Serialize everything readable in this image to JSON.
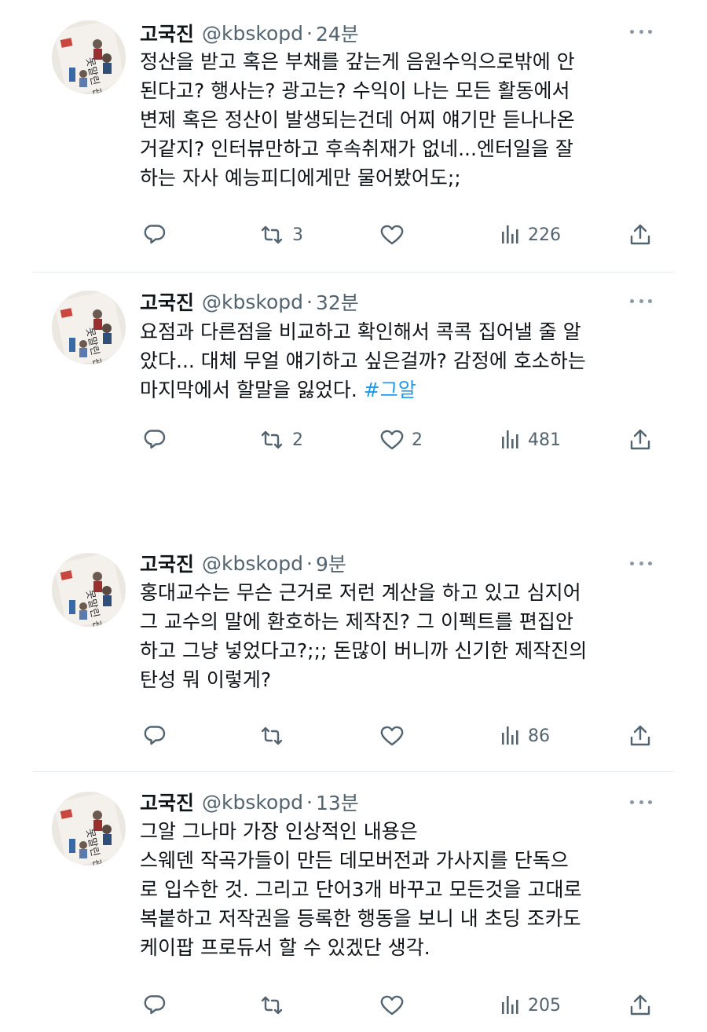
{
  "tweets": [
    {
      "name": "고국진",
      "handle": "@kbskopd",
      "separator": "·",
      "time": "24분",
      "lines": [
        "정산을 받고 혹은 부채를 갚는게 음원수익으로밖에 안",
        "된다고? 행사는? 광고는? 수익이 나는 모든 활동에서",
        "변제 혹은 정산이 발생되는건데 어찌 얘기만 듣나나온",
        "거같지? 인터뷰만하고 후속취재가 없네...엔터일을 잘",
        "하는 자사 예능피디에게만 물어봤어도;;"
      ],
      "hashtag": "",
      "retweets": "3",
      "likes": "",
      "views": "226"
    },
    {
      "name": "고국진",
      "handle": "@kbskopd",
      "separator": "·",
      "time": "32분",
      "lines": [
        "요점과 다른점을 비교하고 확인해서 콕콕 집어낼 줄 알",
        "았다... 대체 무얼 얘기하고 싶은걸까? 감정에 호소하는",
        "마지막에서 할말을 잃었다. "
      ],
      "hashtag": "#그알",
      "retweets": "2",
      "likes": "2",
      "views": "481"
    },
    {
      "name": "고국진",
      "handle": "@kbskopd",
      "separator": "·",
      "time": "9분",
      "lines": [
        "홍대교수는 무슨 근거로 저런 계산을 하고 있고 심지어",
        "그 교수의 말에 환호하는 제작진? 그 이펙트를 편집안",
        "하고 그냥 넣었다고?;;; 돈많이 버니까 신기한 제작진의",
        "탄성 뭐 이렇게?"
      ],
      "hashtag": "",
      "retweets": "",
      "likes": "",
      "views": "86"
    },
    {
      "name": "고국진",
      "handle": "@kbskopd",
      "separator": "·",
      "time": "13분",
      "lines": [
        "그알 그나마 가장 인상적인 내용은",
        "스웨덴 작곡가들이 만든 데모버전과 가사지를 단독으",
        "로 입수한 것. 그리고 단어3개 바꾸고 모든것을 고대로",
        "복붙하고 저작권을 등록한 행동을 보니 내 초딩 조카도",
        "케이팝 프로듀서 할 수 있겠단 생각."
      ],
      "hashtag": "",
      "retweets": "",
      "likes": "",
      "views": "205"
    }
  ],
  "colors": {
    "text": "#0f1419",
    "secondary": "#536471",
    "link": "#1d9bf0",
    "divider": "#e6ecf0"
  },
  "icons": {
    "reply": "reply-icon",
    "retweet": "retweet-icon",
    "like": "heart-icon",
    "views": "views-icon",
    "share": "share-icon",
    "more": "more-icon"
  }
}
